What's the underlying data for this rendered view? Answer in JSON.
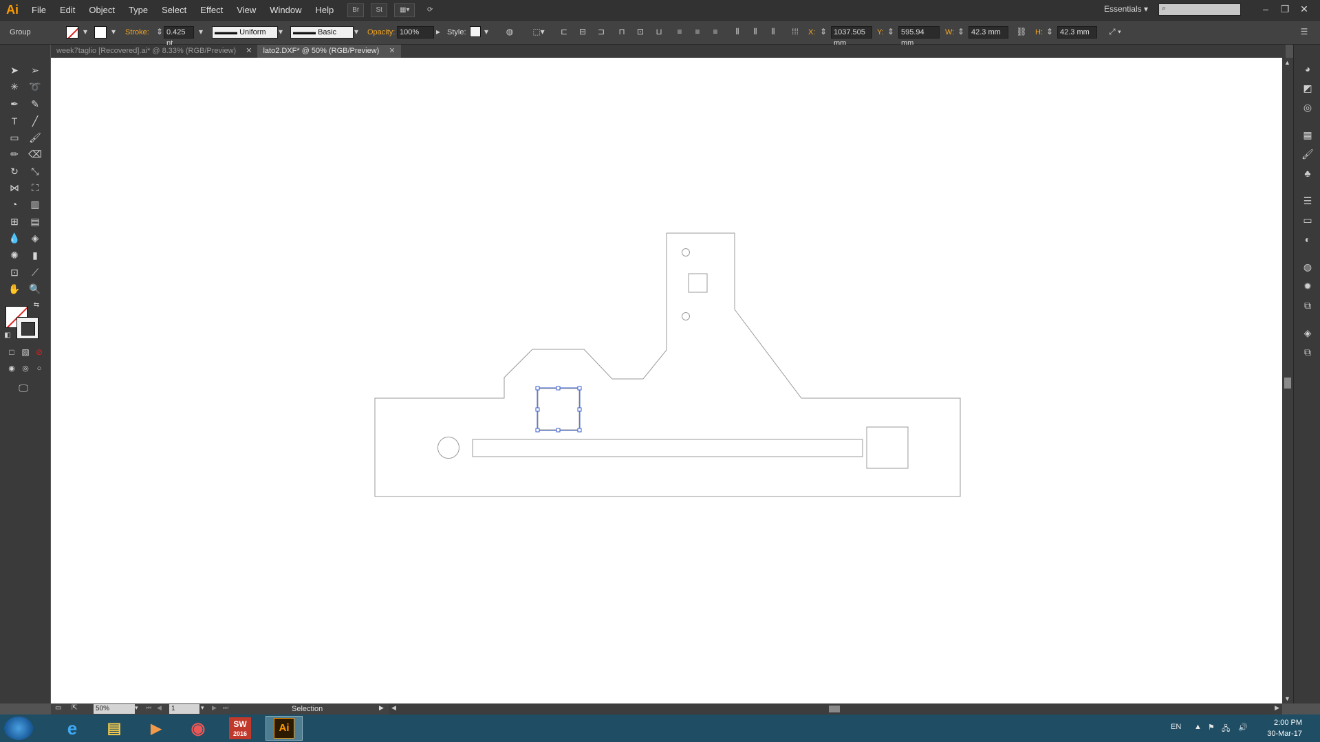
{
  "app": {
    "logo": "Ai",
    "workspace": "Essentials",
    "search_placeholder": ""
  },
  "menu": [
    "File",
    "Edit",
    "Object",
    "Type",
    "Select",
    "Effect",
    "View",
    "Window",
    "Help"
  ],
  "menubar_icons": {
    "br": "Br",
    "st": "St"
  },
  "control": {
    "selection_type": "Group",
    "stroke_label": "Stroke:",
    "stroke_weight": "0.425 pt",
    "profile": "Uniform",
    "brush": "Basic",
    "opacity_label": "Opacity:",
    "opacity": "100%",
    "style_label": "Style:",
    "x_label": "X:",
    "x_value": "1037.505 mm",
    "y_label": "Y:",
    "y_value": "595.94 mm",
    "w_label": "W:",
    "w_value": "42.3 mm",
    "h_label": "H:",
    "h_value": "42.3 mm"
  },
  "tabs": [
    {
      "label": "week7taglio [Recovered].ai* @ 8.33% (RGB/Preview)",
      "active": false
    },
    {
      "label": "lato2.DXF* @ 50% (RGB/Preview)",
      "active": true
    }
  ],
  "status": {
    "zoom": "50%",
    "page": "1",
    "tool": "Selection"
  },
  "taskbar": {
    "apps": [
      "internet-explorer",
      "file-explorer",
      "media-player",
      "chrome",
      "solidworks-2016",
      "illustrator"
    ],
    "sw_label": "SW",
    "sw_year": "2016",
    "ai_label": "Ai",
    "lang": "EN",
    "time": "2:00 PM",
    "date": "30-Mar-17"
  },
  "colors": {
    "selection": "#3a5fd0",
    "accent_orange": "#f5a623",
    "taskbar": "#1f4d63"
  }
}
